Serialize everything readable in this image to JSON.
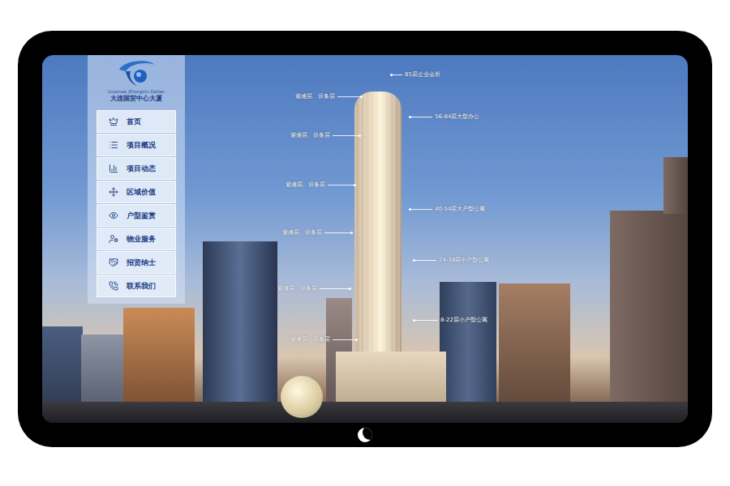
{
  "site": {
    "logo_latin": "Guomao Zhongxin.Dalian",
    "logo_title": "大连国贸中心大厦"
  },
  "menu": [
    {
      "label": "首页"
    },
    {
      "label": "项目概况"
    },
    {
      "label": "项目动态"
    },
    {
      "label": "区域价值"
    },
    {
      "label": "户型鉴赏"
    },
    {
      "label": "物业服务"
    },
    {
      "label": "招贤纳士"
    },
    {
      "label": "联系我们"
    }
  ],
  "annotations": [
    {
      "label": "85层企业会所",
      "kind": "use"
    },
    {
      "label": "避难层、设备层",
      "kind": "refuge"
    },
    {
      "label": "56-84层大型办公",
      "kind": "use"
    },
    {
      "label": "避难层、设备层",
      "kind": "refuge"
    },
    {
      "label": "避难层、设备层",
      "kind": "refuge"
    },
    {
      "label": "40-54层大户型公寓",
      "kind": "use"
    },
    {
      "label": "避难层、设备层",
      "kind": "refuge"
    },
    {
      "label": "24-38层中户型公寓",
      "kind": "use"
    },
    {
      "label": "避难层、设备层",
      "kind": "refuge"
    },
    {
      "label": "8-22层小户型公寓",
      "kind": "use"
    },
    {
      "label": "避难层、设备层",
      "kind": "refuge"
    }
  ]
}
